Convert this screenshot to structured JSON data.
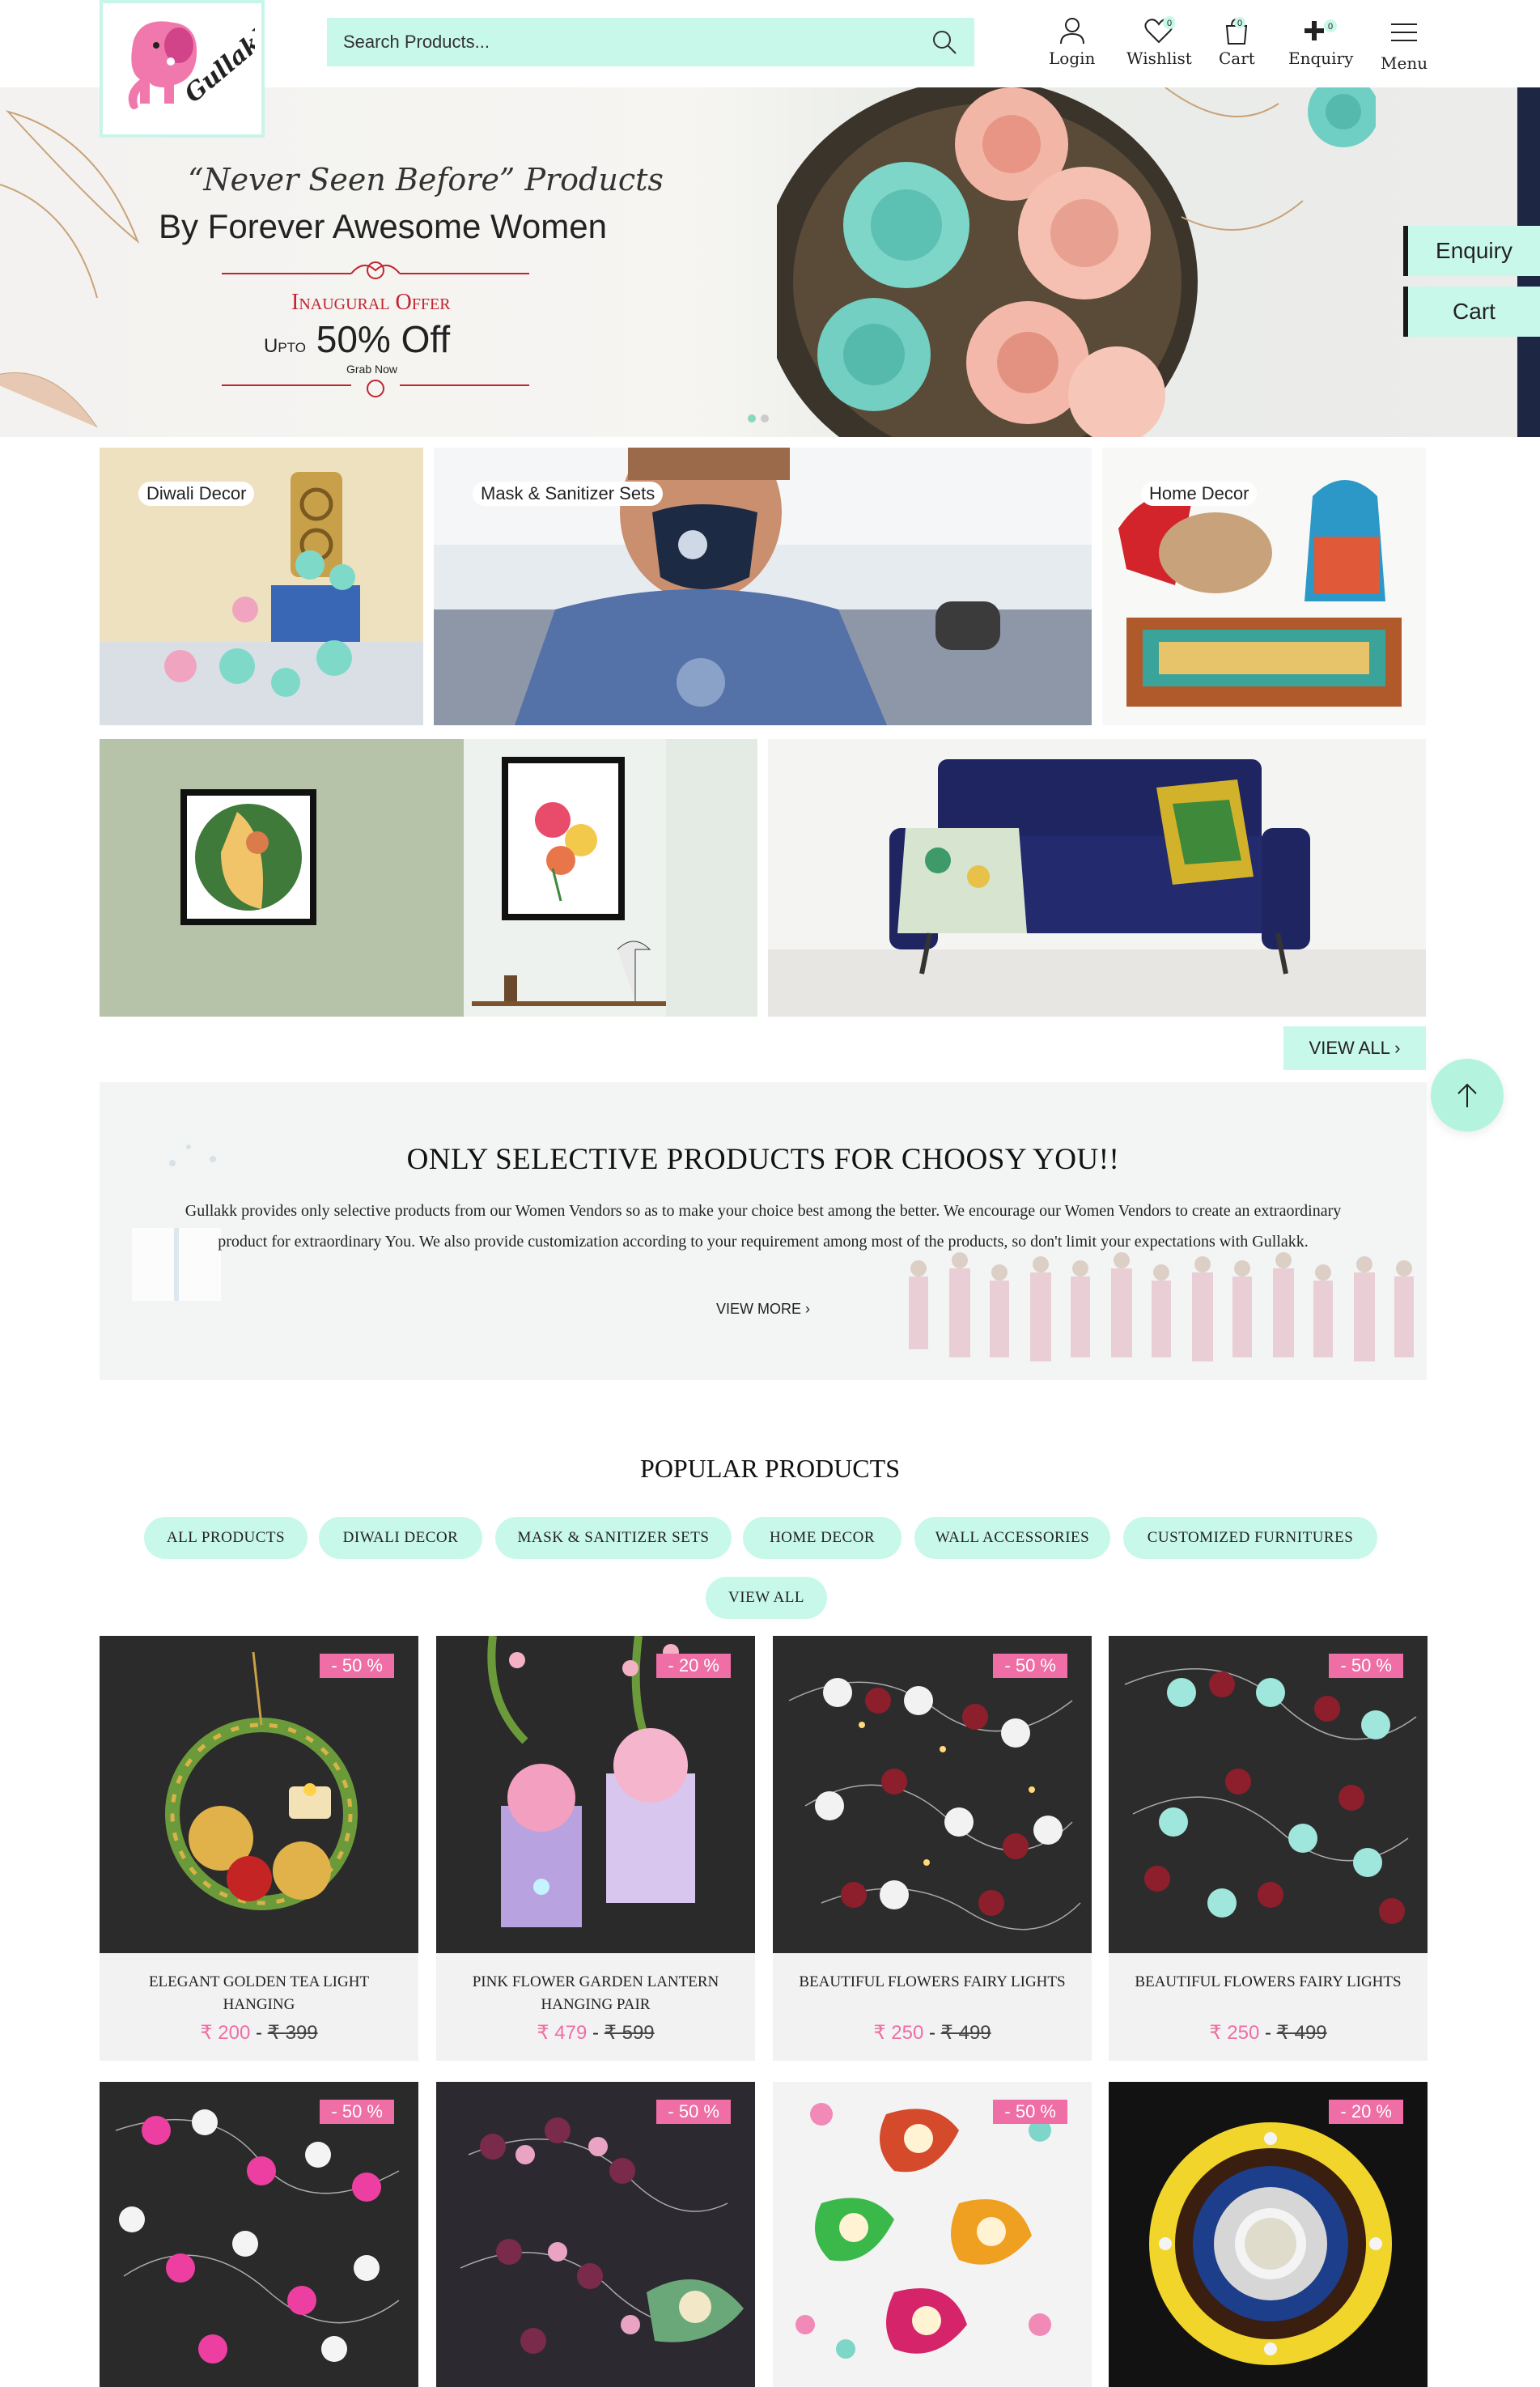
{
  "header": {
    "logo_text": "Gullakk",
    "search_placeholder": "Search Products...",
    "nav": [
      {
        "label": "Login",
        "icon": "user-icon"
      },
      {
        "label": "Wishlist",
        "icon": "heart-icon",
        "count": "0"
      },
      {
        "label": "Cart",
        "icon": "bag-icon",
        "count": "0"
      },
      {
        "label": "Enquiry",
        "icon": "plus-icon",
        "count": "0"
      },
      {
        "label": "Menu",
        "icon": "hamburger-icon"
      }
    ]
  },
  "hero": {
    "tagline": "“Never Seen Before” Products",
    "headline": "By Forever Awesome Women",
    "offer_title": "Inaugural Offer",
    "offer_prefix": "Upto",
    "offer_amount": "50%",
    "offer_suffix": "Off",
    "offer_cta": "Grab Now"
  },
  "side_buttons": {
    "enquiry": "Enquiry",
    "cart": "Cart"
  },
  "categories": [
    {
      "label": "Diwali Decor"
    },
    {
      "label": "Mask & Sanitizer Sets"
    },
    {
      "label": "Home Decor"
    }
  ],
  "view_all": "VIEW ALL ›",
  "about": {
    "title": "ONLY SELECTIVE PRODUCTS FOR CHOOSY YOU!!",
    "body": "Gullakk provides only selective products from our Women Vendors so as to make your choice best among the better. We encourage our Women Vendors to create an extraordinary product for extraordinary You. We also provide customization according to your requirement among most of the products, so don't limit your expectations with Gullakk.",
    "view_more": "VIEW MORE ›"
  },
  "popular": {
    "title": "POPULAR PRODUCTS",
    "filters": [
      "ALL PRODUCTS",
      "DIWALI DECOR",
      "MASK & SANITIZER SETS",
      "HOME DECOR",
      "WALL ACCESSORIES",
      "CUSTOMIZED FURNITURES"
    ],
    "view_all": "VIEW ALL",
    "products": [
      {
        "badge": "- 50 %",
        "name": "ELEGANT GOLDEN TEA LIGHT HANGING",
        "price": "₹ 200",
        "old_price": "₹ 399"
      },
      {
        "badge": "- 20 %",
        "name": "PINK FLOWER GARDEN LANTERN HANGING PAIR",
        "price": "₹ 479",
        "old_price": "₹ 599"
      },
      {
        "badge": "- 50 %",
        "name": "BEAUTIFUL FLOWERS FAIRY LIGHTS",
        "price": "₹ 250",
        "old_price": "₹ 499"
      },
      {
        "badge": "- 50 %",
        "name": "BEAUTIFUL FLOWERS FAIRY LIGHTS",
        "price": "₹ 250",
        "old_price": "₹ 499"
      },
      {
        "badge": "- 50 %"
      },
      {
        "badge": "- 50 %"
      },
      {
        "badge": "- 50 %"
      },
      {
        "badge": "- 20 %"
      }
    ]
  },
  "colors": {
    "accent": "#c8f8ea",
    "badge": "#ee6ea5",
    "offer_red": "#c3232f"
  }
}
